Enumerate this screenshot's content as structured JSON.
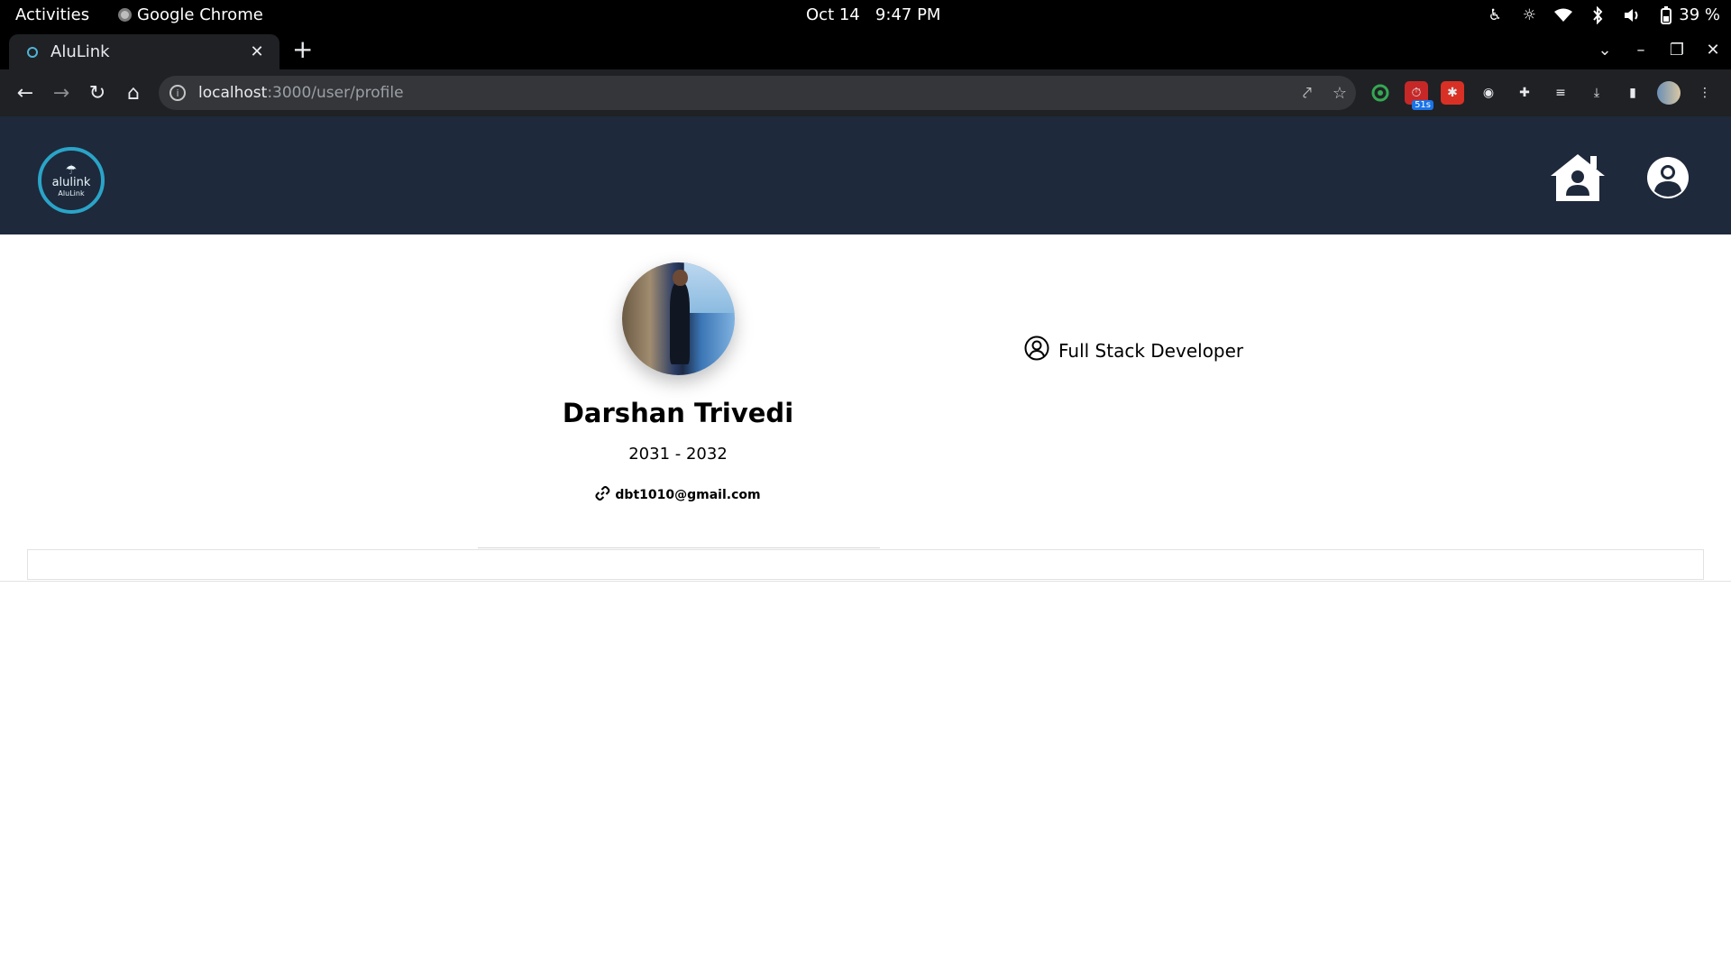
{
  "system_bar": {
    "activities": "Activities",
    "app_name": "Google Chrome",
    "date": "Oct 14",
    "time": "9:47 PM",
    "battery": "39 %"
  },
  "browser": {
    "tab_title": "AluLink",
    "url_host": "localhost",
    "url_path": ":3000/user/profile",
    "extension_badge": "51s"
  },
  "app": {
    "logo_text": "alulink",
    "logo_subtext": "AluLink"
  },
  "profile": {
    "name": "Darshan Trivedi",
    "years": "2031 - 2032",
    "email": "dbt1010@gmail.com",
    "role": "Full Stack Developer"
  },
  "colors": {
    "navbar_bg": "#1e293b",
    "logo_accent": "#2aa4c8"
  }
}
